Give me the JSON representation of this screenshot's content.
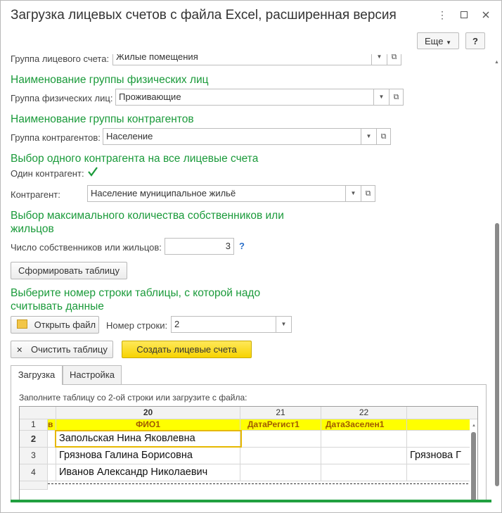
{
  "window": {
    "title": "Загрузка лицевых счетов с файла Excel, расширенная версия",
    "more_label": "Еще",
    "help_label": "?"
  },
  "form": {
    "account_group": {
      "label": "Группа лицевого счета:",
      "value": "Жилые помещения"
    },
    "individuals_heading": "Наименование группы физических лиц",
    "individuals_group": {
      "label": "Группа физических лиц:",
      "value": "Проживающие"
    },
    "counterparties_heading": "Наименование группы контрагентов",
    "counterparties_group": {
      "label": "Группа контрагентов:",
      "value": "Население"
    },
    "single_cp_heading": "Выбор одного контрагента на все лицевые счета",
    "single_cp_label": "Один контрагент:",
    "counterparty": {
      "label": "Контрагент:",
      "value": "Население муниципальное жильё"
    },
    "owners_heading_line1": "Выбор максимального количества собственников или",
    "owners_heading_line2": "жильцов",
    "owners_count": {
      "label": "Число собственников или жильцов:",
      "value": "3",
      "help": "?"
    },
    "build_table_label": "Сформировать таблицу",
    "row_heading_line1": "Выберите номер строки таблицы, с которой надо",
    "row_heading_line2": "считывать данные",
    "open_file_label": "Открыть файл",
    "row_number": {
      "label": "Номер строки:",
      "value": "2"
    },
    "clear_table_label": "Очистить таблицу",
    "create_accounts_label": "Создать лицевые счета"
  },
  "tabs": [
    {
      "label": "Загрузка",
      "active": true
    },
    {
      "label": "Настройка",
      "active": false
    }
  ],
  "load_tab": {
    "hint": "Заполните таблицу со 2-ой строки или загрузите с файла:",
    "columns": [
      "20",
      "21",
      "22"
    ],
    "rows": [
      {
        "n": "1",
        "a": "в",
        "b": "ФИО1",
        "c": "ДатаРегист1",
        "d": "ДатаЗаселен1",
        "e": ""
      },
      {
        "n": "2",
        "a": "",
        "b": "Запольская Нина Яковлевна",
        "c": "",
        "d": "",
        "e": ""
      },
      {
        "n": "3",
        "a": "",
        "b": "Грязнова Галина Борисовна",
        "c": "",
        "d": "",
        "e": "Грязнова Г"
      },
      {
        "n": "4",
        "a": "",
        "b": "Иванов Александр Николаевич",
        "c": "",
        "d": "",
        "e": ""
      }
    ]
  },
  "colors": {
    "accent_green": "#1a9a3a",
    "header_yellow": "#ffff00",
    "button_yellow": "#f7d300",
    "selection_border": "#e6b800"
  }
}
